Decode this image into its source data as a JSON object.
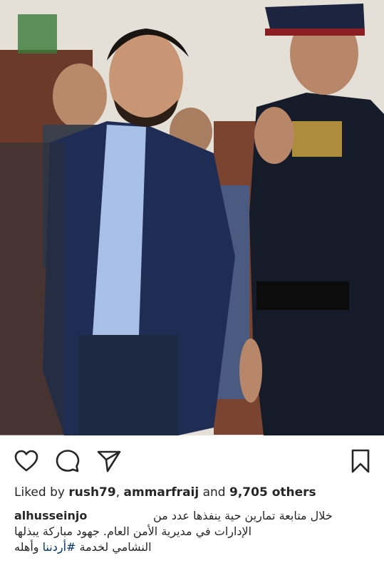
{
  "post": {
    "photo_alt": "",
    "likes": {
      "prefix": "Liked by ",
      "user1": "rush79",
      "sep": ", ",
      "user2": "ammarfraij",
      "and": " and ",
      "others": "9,705 others"
    },
    "caption": {
      "username": "alhusseinjo",
      "line1": "خلال متابعة تمارين حية ينفذها عدد من",
      "line2": "الإدارات في مديرية الأمن العام. جهود مباركة يبذلها",
      "line3_text": "النشامي لخدمة ",
      "hashtag": "#أردننا",
      "line3_end": " وأهله"
    }
  },
  "icons": {
    "like": "heart-icon",
    "comment": "comment-icon",
    "share": "send-icon",
    "save": "bookmark-icon"
  },
  "colors": {
    "text": "#262626",
    "hashtag": "#003569"
  }
}
